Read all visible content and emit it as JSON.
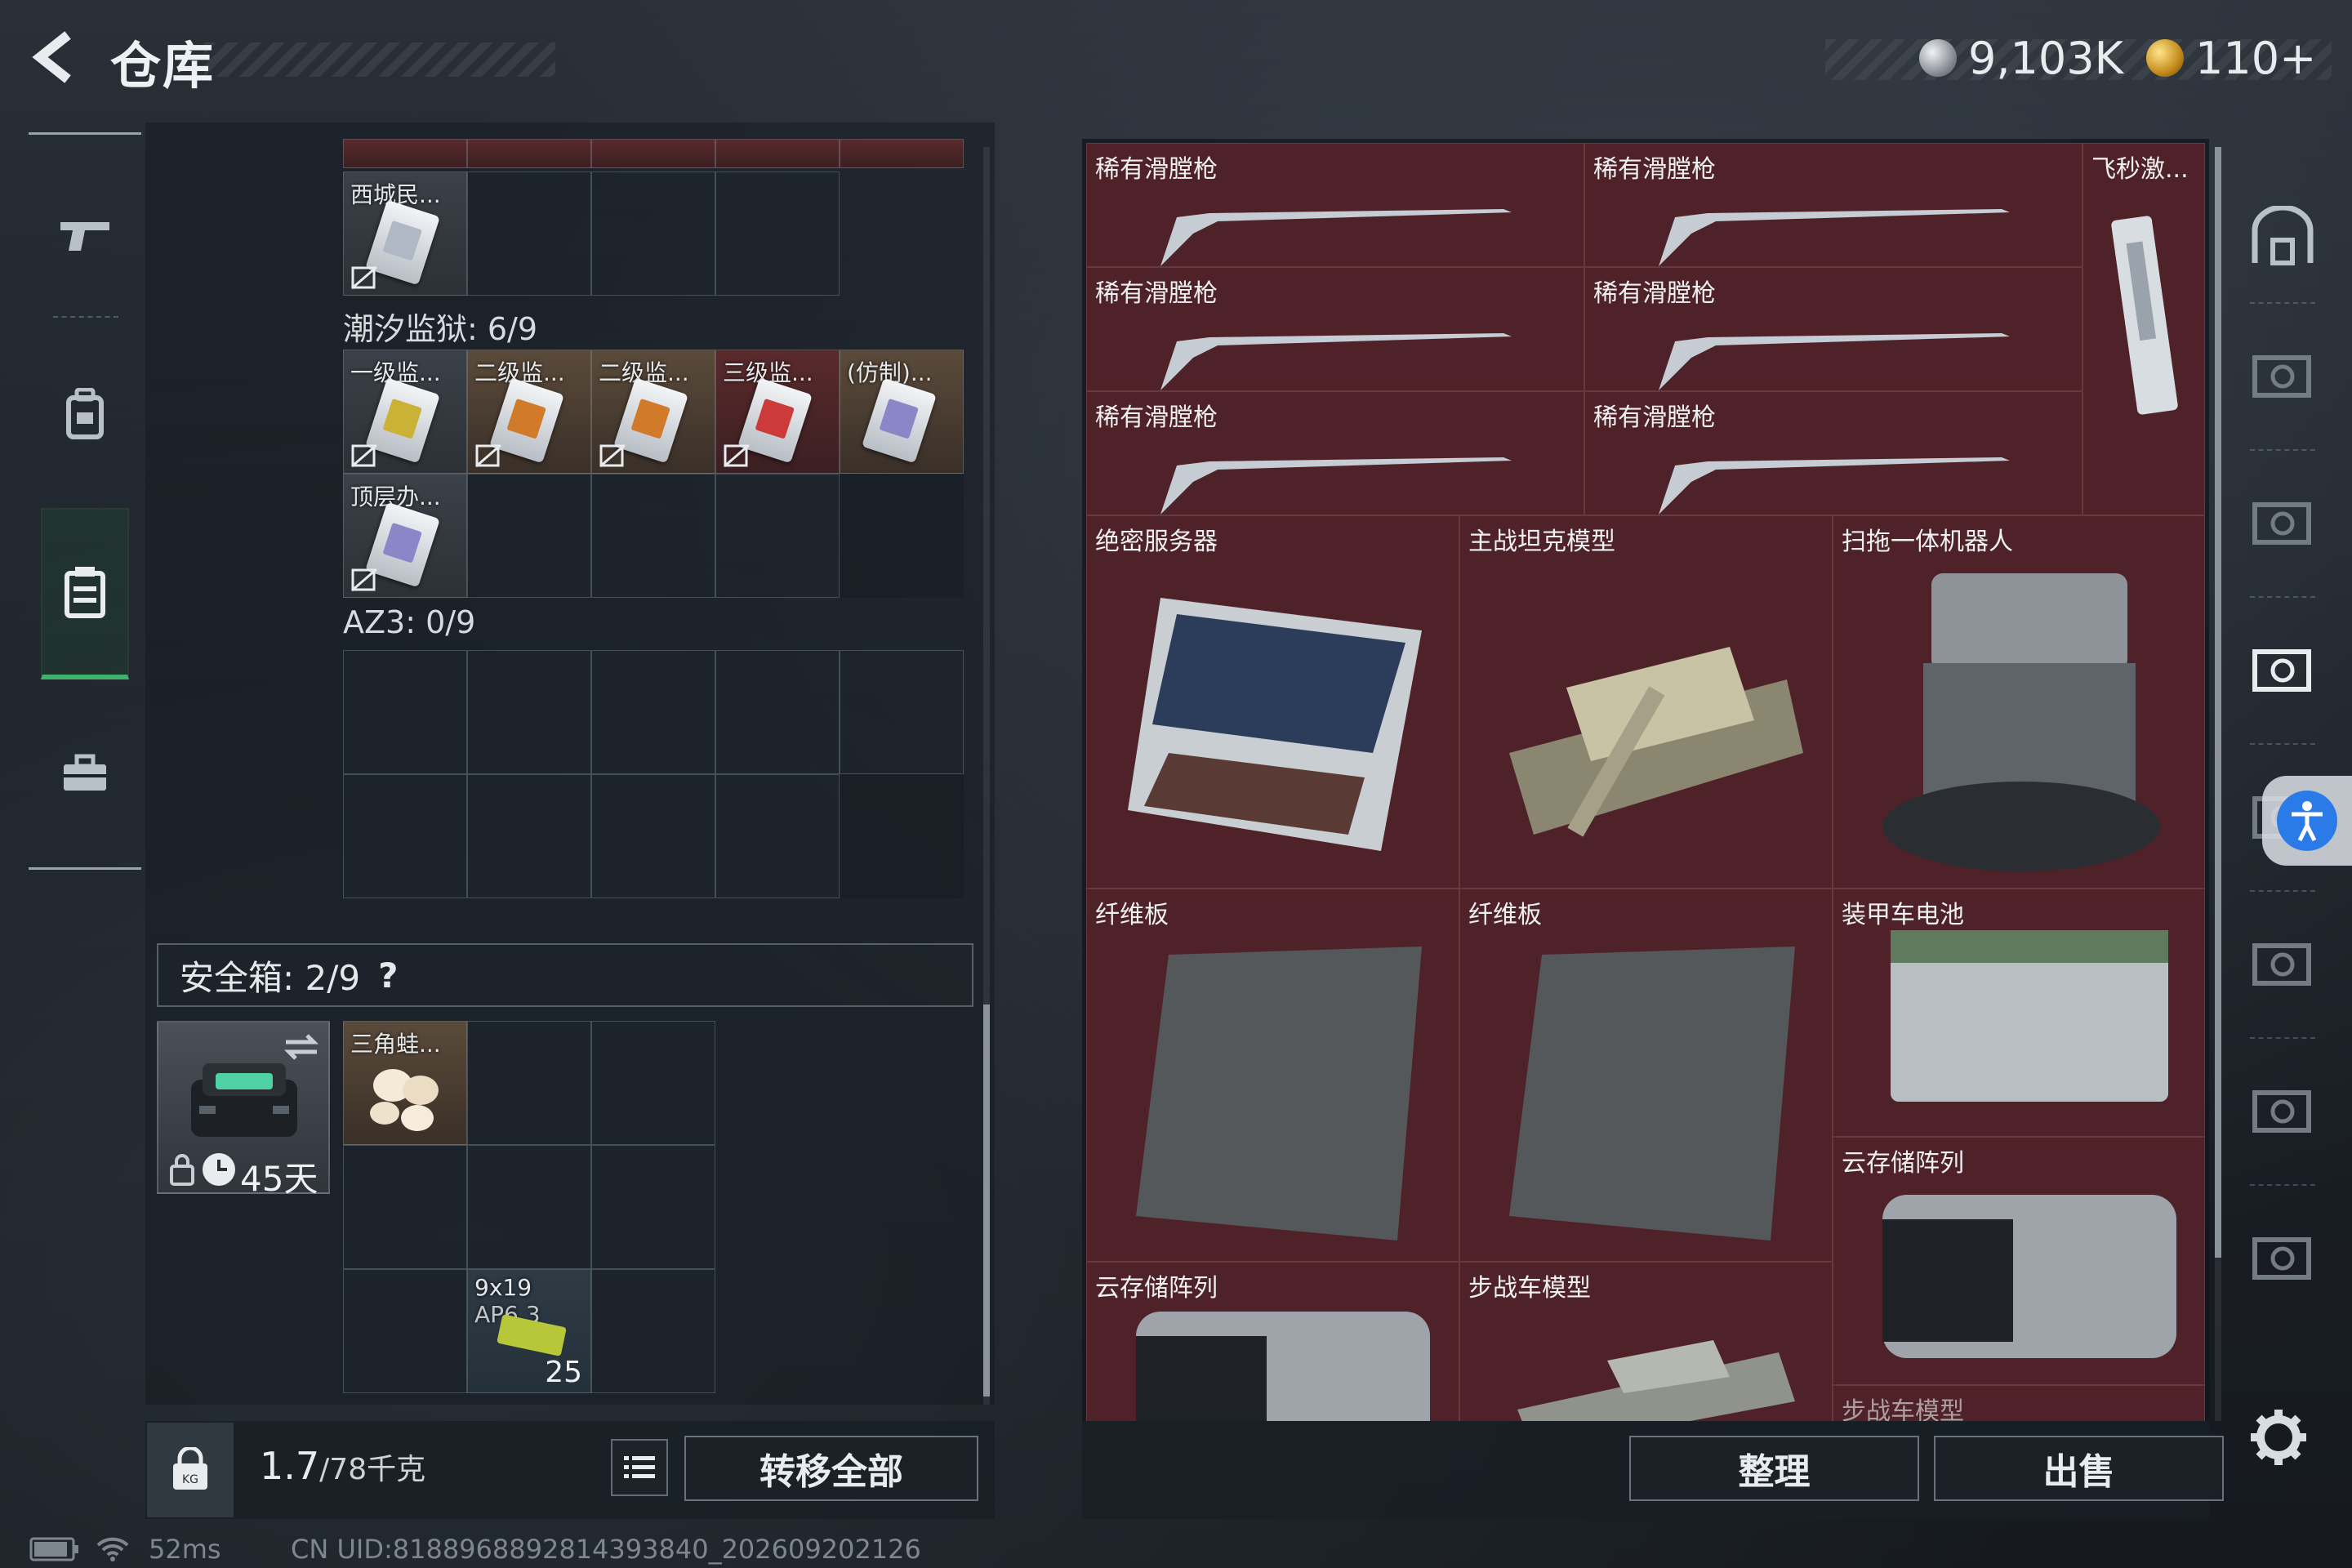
{
  "header": {
    "title": "仓库",
    "currency_1": "9,103K",
    "currency_2": "110+"
  },
  "left_nav": {
    "items": [
      "weapon",
      "backpack",
      "container",
      "toolbox"
    ],
    "active": "container"
  },
  "inventory": {
    "top_row_label": "西城民...",
    "section_1": {
      "label": "潮汐监狱: 6/9",
      "items": [
        "一级监...",
        "二级监...",
        "二级监...",
        "三级监...",
        "(仿制)...",
        "顶层办..."
      ]
    },
    "section_2": {
      "label": "AZ3: 0/9"
    },
    "safe_box": {
      "label": "安全箱: 2/9",
      "help": "?",
      "case_timer": "45天",
      "item_1": "三角蛙...",
      "ammo_label_1": "9x19",
      "ammo_label_2": "AP6.3",
      "ammo_count": "25"
    }
  },
  "weight": {
    "current": "1.7",
    "max": "/78千克"
  },
  "buttons": {
    "transfer_all": "转移全部",
    "organize": "整理",
    "sell": "出售"
  },
  "stash": {
    "guns": [
      "稀有滑膛枪",
      "稀有滑膛枪",
      "稀有滑膛枪",
      "稀有滑膛枪",
      "稀有滑膛枪",
      "稀有滑膛枪"
    ],
    "gun_tall": "飞秒激...",
    "large": [
      "绝密服务器",
      "主战坦克模型",
      "扫拖一体机器人"
    ],
    "row3": [
      "纤维板",
      "纤维板",
      "装甲车电池"
    ],
    "cloud_1": "云存储阵列",
    "row4": [
      "云存储阵列",
      "步战车模型"
    ],
    "partial": "步战车模型"
  },
  "status": {
    "ping": "52ms",
    "uid": "CN UID:8188968892814393840_202609202126"
  },
  "colors": {
    "stash_item_bg": "#4e2228",
    "active_green": "#3fb26e"
  }
}
